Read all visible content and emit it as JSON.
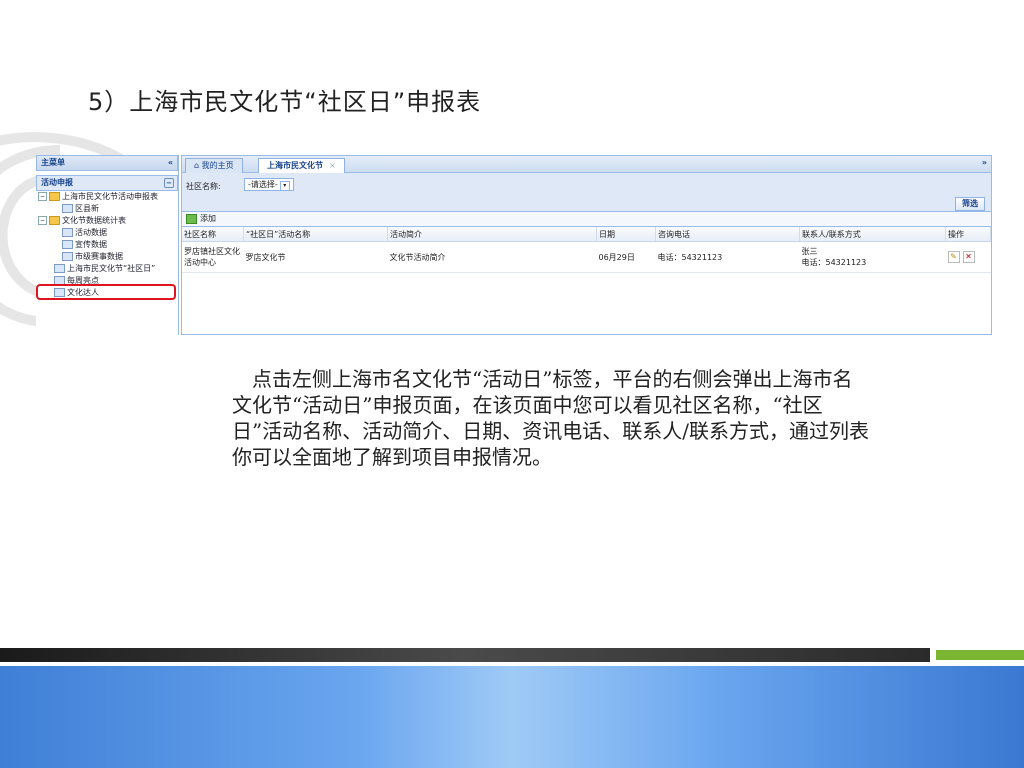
{
  "slide": {
    "title": "5）上海市民文化节“社区日”申报表",
    "description": "点击左侧上海市名文化节“活动日”标签，平台的右侧会弹出上海市名文化节“活动日”申报页面，在该页面中您可以看见社区名称，“社区日”活动名称、活动简介、日期、资讯电话、联系人/联系方式，通过列表你可以全面地了解到项目申报情况。"
  },
  "sidebar": {
    "header": "主菜单",
    "collapse": "«",
    "group": "活动申报",
    "group_tool": "−",
    "items": [
      {
        "label": "上海市民文化节活动申报表",
        "expand": "−"
      },
      {
        "label": "区县新"
      },
      {
        "label": "文化节数据统计表",
        "expand": "−"
      },
      {
        "label": "活动数据"
      },
      {
        "label": "宣传数据"
      },
      {
        "label": "市级赛事数据"
      },
      {
        "label": "上海市民文化节“社区日”"
      },
      {
        "label": "每周亮点"
      },
      {
        "label": "文化达人"
      }
    ]
  },
  "tabs": {
    "home": "⌂ 我的主页",
    "active": "上海市民文化节",
    "close": "×",
    "more": "»"
  },
  "filter": {
    "label": "社区名称:",
    "select_value": "-请选择-",
    "dd": "▾",
    "button": "筛选"
  },
  "toolbar": {
    "add": "添加"
  },
  "table": {
    "columns": [
      "社区名称",
      "“社区日”活动名称",
      "活动简介",
      "日期",
      "咨询电话",
      "联系人/联系方式",
      "操作"
    ],
    "rows": [
      {
        "community": "罗店镇社区文化活动中心",
        "activity": "罗店文化节",
        "intro": "文化节活动简介",
        "date": "06月29日",
        "phone": "电话：54321123",
        "contact_name": "张三",
        "contact_phone": "电话：54321123",
        "edit": "✎",
        "delete": "✕"
      }
    ]
  }
}
